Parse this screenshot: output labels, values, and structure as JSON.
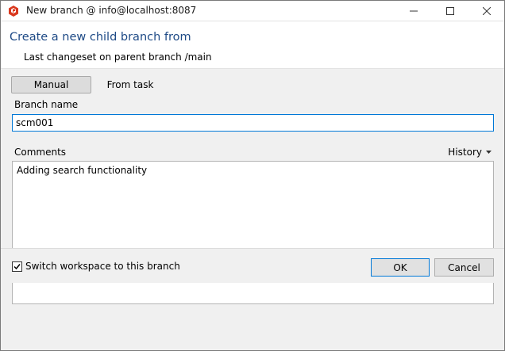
{
  "window": {
    "title": "New branch @ info@localhost:8087"
  },
  "header": {
    "title": "Create a new child branch from",
    "subtitle": "Last changeset on parent branch /main"
  },
  "tabs": {
    "manual": "Manual",
    "from_task": "From task"
  },
  "branch": {
    "label": "Branch name",
    "value": "scm001"
  },
  "comments": {
    "label": "Comments",
    "history_label": "History",
    "value": "Adding search functionality"
  },
  "footer": {
    "switch_label": "Switch workspace to this branch",
    "switch_checked": true,
    "ok_label": "OK",
    "cancel_label": "Cancel"
  },
  "colors": {
    "accent": "#0078d7",
    "header_title": "#1e4a86",
    "app_icon": "#d9381e"
  },
  "icons": {
    "app": "plastic-scm-icon",
    "minimize": "minimize-icon",
    "maximize": "maximize-icon",
    "close": "close-icon",
    "history_dropdown": "chevron-down-icon",
    "checkbox": "checkmark-icon"
  }
}
